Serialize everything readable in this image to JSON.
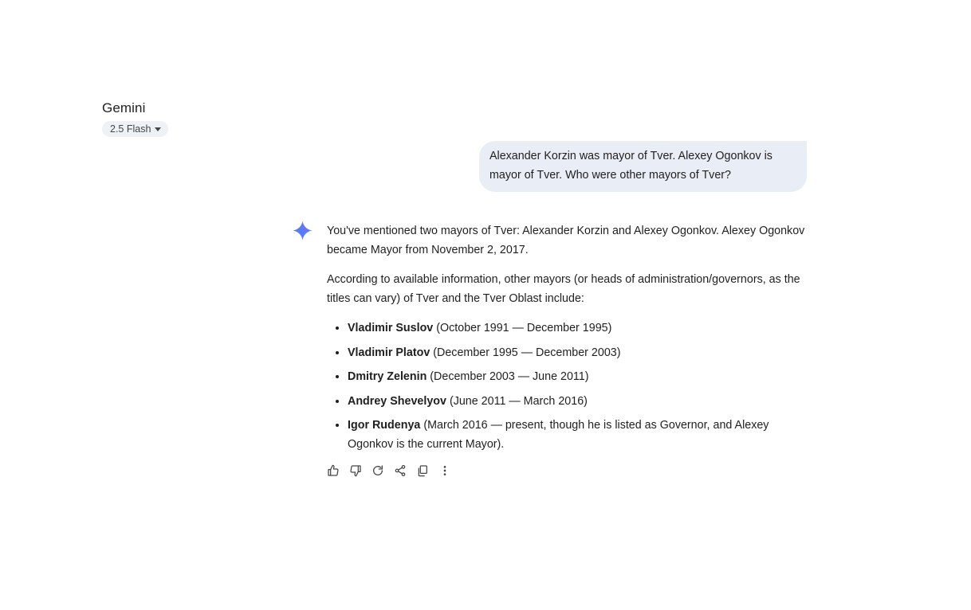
{
  "app": {
    "title": "Gemini",
    "model_label": "2.5 Flash"
  },
  "conversation": {
    "user_message": "Alexander Korzin was mayor of Tver. Alexey Ogonkov is mayor of Tver. Who were other mayors of Tver?",
    "response": {
      "paragraph_1": "You've mentioned two mayors of Tver: Alexander Korzin and Alexey Ogonkov. Alexey Ogonkov became Mayor from November 2, 2017.",
      "paragraph_2": "According to available information, other mayors (or heads of administration/governors, as the titles can vary) of Tver and the Tver Oblast include:",
      "mayors": [
        {
          "name": "Vladimir Suslov",
          "detail": " (October 1991 — December 1995)"
        },
        {
          "name": "Vladimir Platov",
          "detail": " (December 1995 — December 2003)"
        },
        {
          "name": "Dmitry Zelenin",
          "detail": " (December 2003 — June 2011)"
        },
        {
          "name": "Andrey Shevelyov",
          "detail": " (June 2011 — March 2016)"
        },
        {
          "name": "Igor Rudenya",
          "detail": " (March 2016 — present, though he is listed as Governor, and Alexey Ogonkov is the current Mayor)."
        }
      ]
    }
  },
  "icons": {
    "gemini": "gemini-sparkle-icon",
    "actions": [
      "thumbs-up-icon",
      "thumbs-down-icon",
      "regenerate-icon",
      "share-icon",
      "copy-icon",
      "more-options-icon"
    ],
    "accent_gradient": [
      "#4285f4",
      "#7b6ff2"
    ]
  }
}
